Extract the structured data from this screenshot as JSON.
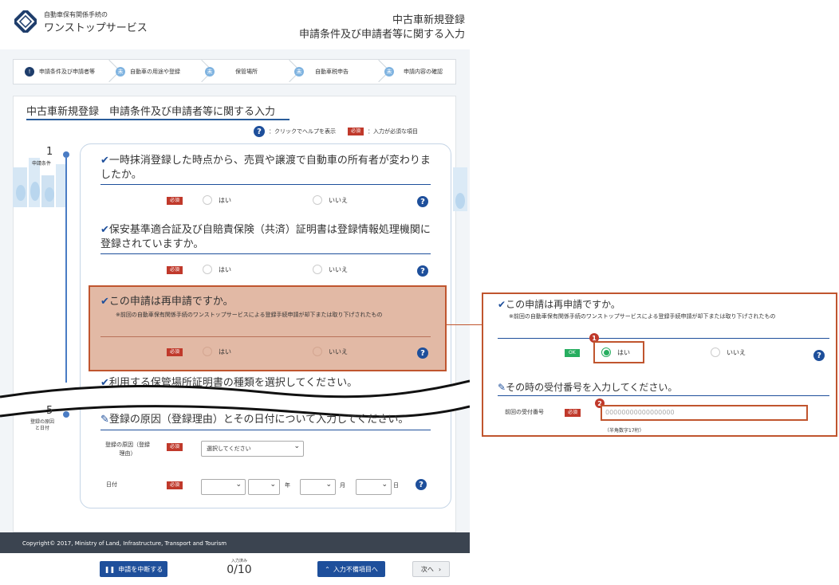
{
  "header": {
    "logo_line1": "自動車保有関係手続の",
    "logo_line2": "ワンストップサービス",
    "title_line1": "中古車新規登録",
    "title_line2": "申請条件及び申請者等に関する入力"
  },
  "steps": [
    {
      "icon": "!",
      "label": "申請条件及び申請者等"
    },
    {
      "icon": "未",
      "label": "自動車の用途や登録"
    },
    {
      "icon": "未",
      "label": "保管場所"
    },
    {
      "icon": "未",
      "label": "自動車税申告"
    },
    {
      "icon": "未",
      "label": "申請内容の確認"
    }
  ],
  "page_title": "中古車新規登録　申請条件及び申請者等に関する入力",
  "help_note": {
    "help_text": "：クリックでヘルプを表示",
    "req_badge": "必須",
    "req_text": "：入力が必須な項目"
  },
  "sidebar": {
    "section1_num": "1",
    "section1_label": "申請条件",
    "section5_num": "5",
    "section5_label": "登録の原因と日付"
  },
  "questions": [
    {
      "text": "一時抹消登録した時点から、売買や譲渡で自動車の所有者が変わりましたか。",
      "req": "必須",
      "yes": "はい",
      "no": "いいえ"
    },
    {
      "text": "保安基準適合証及び自賠責保険（共済）証明書は登録情報処理機関に登録されていますか。",
      "req": "必須",
      "yes": "はい",
      "no": "いいえ"
    },
    {
      "text": "この申請は再申請ですか。",
      "note": "※前回の自動車保有関係手続のワンストップサービスによる登録手続申請が却下または取り下げされたもの",
      "req": "必須",
      "yes": "はい",
      "no": "いいえ"
    },
    {
      "text": "利用する保管場所証明書の種類を選択してください。"
    }
  ],
  "section5": {
    "title": "登録の原因（登録理由）とその日付について入力してください。",
    "reason_label": "登録の原因（登録理由）",
    "reason_req": "必須",
    "reason_select": "選択してください",
    "date_label": "日付",
    "date_req": "必須",
    "year_unit": "年",
    "month_unit": "月",
    "day_unit": "日"
  },
  "footer": {
    "copyright": "Copyright© 2017, Ministry of Land, Infrastructure, Transport and Tourism"
  },
  "bottom_bar": {
    "suspend": "申請を中断する",
    "progress_label": "入力済み",
    "progress_value": "0/10",
    "incomplete": "入力不備項目へ",
    "next": "次へ"
  },
  "callout": {
    "question": "この申請は再申請ですか。",
    "note": "※前回の自動車保有関係手続のワンストップサービスによる登録手続申請が却下または取り下げされたもの",
    "ok_badge": "OK",
    "yes": "はい",
    "no": "いいえ",
    "selected": "はい",
    "badge1": "1",
    "sub_question": "その時の受付番号を入力してください。",
    "field_label": "前回の受付番号",
    "field_req": "必須",
    "badge2": "2",
    "field_placeholder": "00000000000000000",
    "field_hint": "（半角数字17桁）"
  },
  "colors": {
    "accent": "#1e4f9b",
    "required": "#c0392b",
    "ok": "#27ae60",
    "highlight": "#e2b9a5",
    "callout_border": "#c0552e"
  }
}
